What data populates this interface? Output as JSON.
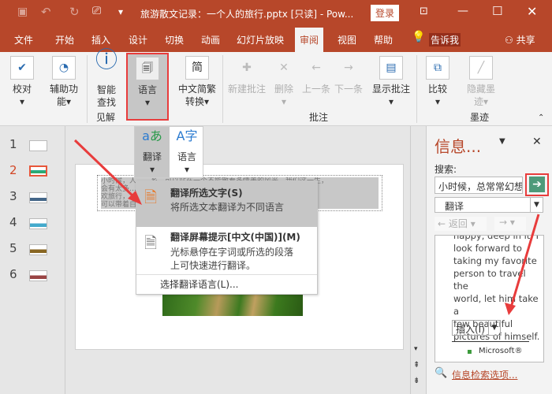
{
  "titlebar": {
    "title": "旅游散文记录：一个人的旅行.pptx [只读]  -  Pow...",
    "login": "登录",
    "qat_more": "▾"
  },
  "tabs": [
    "文件",
    "开始",
    "插入",
    "设计",
    "切换",
    "动画",
    "幻灯片放映",
    "审阅",
    "视图",
    "帮助"
  ],
  "tell_me": "告诉我",
  "share": "共享",
  "ribbon": {
    "proofing": "校对",
    "accessibility_1": "辅助功",
    "accessibility_2": "能",
    "smart_1": "智能",
    "smart_2": "查找",
    "insights": "见解",
    "language": "语言",
    "chinese_1": "中文简繁",
    "chinese_2": "转换",
    "new_comment": "新建批注",
    "delete": "删除",
    "prev": "上一条",
    "next": "下一条",
    "show_comments": "显示批注",
    "comments_group": "批注",
    "compare": "比较",
    "hide_ink_1": "隐藏墨",
    "hide_ink_2": "迹",
    "ink_group": "墨迹"
  },
  "gallery": {
    "translate": "翻译",
    "language": "语言"
  },
  "menu": {
    "item1_title": "翻译所选文字(S)",
    "item1_desc": "将所选文本翻译为不同语言",
    "item2_title": "翻译屏幕提示[中文(中国)](M)",
    "item2_desc1": "光标悬停在字词或所选的段落",
    "item2_desc2": "上可快速进行翻译。",
    "item3": "选择翻译语言(L)..."
  },
  "slides": [
    "1",
    "2",
    "3",
    "4",
    "5",
    "6"
  ],
  "slide_text": [
    "小时候，人……乡，可以站在一个不能散看多情美的风光。我们这一生，",
    "会有太多……在自己的心中。我喜",
    "欢旅行，……深陷其中。我期盼",
    "可以带着自"
  ],
  "pane": {
    "title": "信息...",
    "search_label": "搜索:",
    "search_value": "小时候，总常常幻想",
    "service": "翻译",
    "back": "返回",
    "result_lines": [
      "happy, deep in it. I",
      "look forward to",
      "taking my favorite",
      "person to travel the",
      "world, let him take a",
      "few beautiful",
      "pictures of himself."
    ],
    "insert": "插入(I)",
    "ms": "Microsoft®",
    "options": "信息检索选项..."
  },
  "colors": {
    "accent": "#b7472a",
    "highlight": "#e83c3c"
  }
}
